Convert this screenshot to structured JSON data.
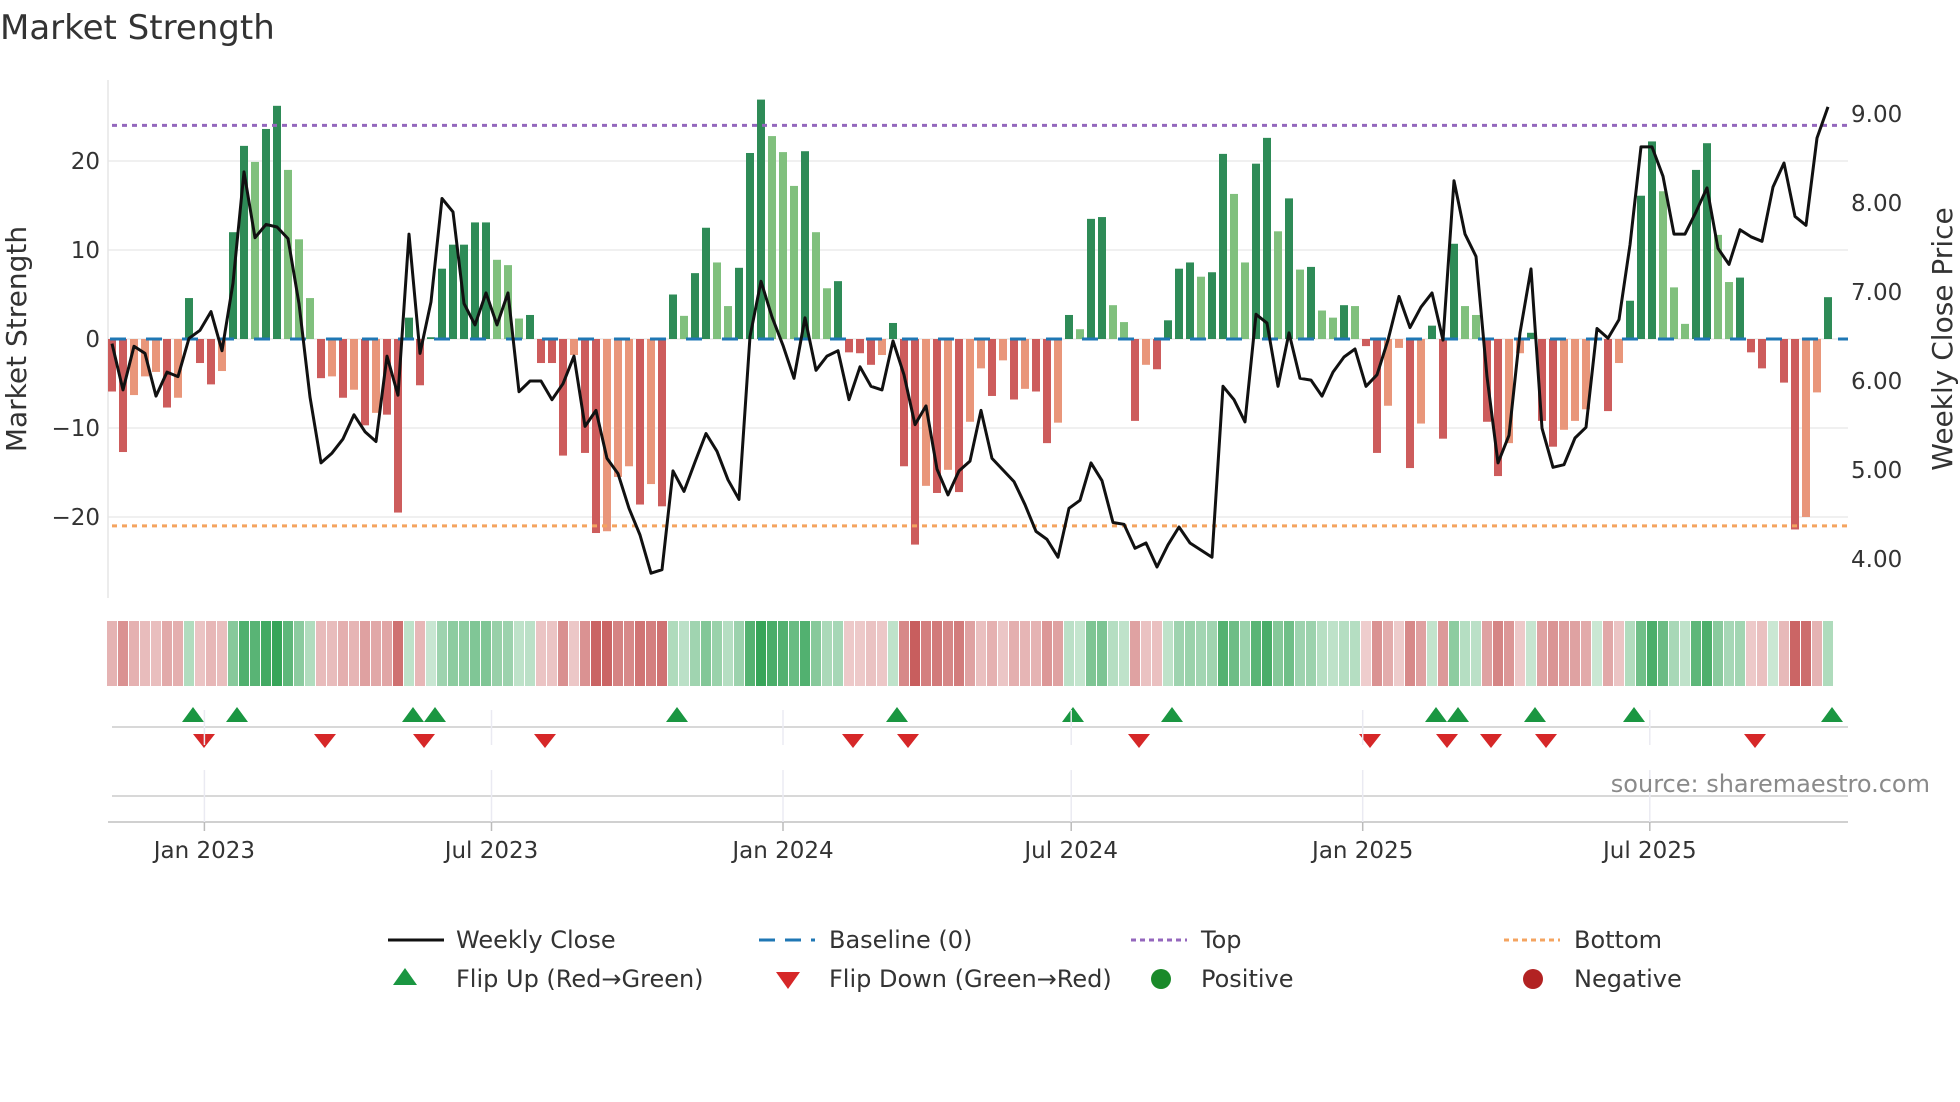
{
  "title": "Market Strength",
  "source": "source: sharemaestro.com",
  "legend": [
    {
      "label": "Weekly Close",
      "icon": "solid-line"
    },
    {
      "label": "Baseline (0)",
      "icon": "dashed-line"
    },
    {
      "label": "Top",
      "icon": "dotted-line"
    },
    {
      "label": "Bottom",
      "icon": "dotted-line"
    },
    {
      "label": "Flip Up (Red→Green)",
      "icon": "triangle-up"
    },
    {
      "label": "Flip Down (Green→Red)",
      "icon": "triangle-down"
    },
    {
      "label": "Positive",
      "icon": "circle"
    },
    {
      "label": "Negative",
      "icon": "circle"
    }
  ],
  "colors": {
    "pos_strong": "#2e8b57",
    "pos_weak": "#80c07d",
    "neg_strong": "#cd5c5c",
    "neg_weak": "#e9967a",
    "line": "#111111",
    "baseline": "#1f77b4",
    "top": "#9467bd",
    "bottom": "#f4a460",
    "flip_up": "#1a9641",
    "flip_down": "#d62728",
    "positive": "#1a8a2a",
    "negative": "#b22222",
    "grid": "#ececec"
  },
  "chart_data": {
    "type": "bar",
    "title": "Market Strength",
    "ylabel": "Market Strength",
    "y2label": "Weekly Close Price",
    "ylim": [
      -28,
      32
    ],
    "y2lim": [
      3.7,
      9.4
    ],
    "yticks": [
      {
        "v": 20,
        "label": "20"
      },
      {
        "v": 10,
        "label": "10"
      },
      {
        "v": 0,
        "label": "0"
      },
      {
        "v": -10,
        "label": "−10"
      },
      {
        "v": -20,
        "label": "−20"
      }
    ],
    "y2ticks": [
      {
        "v": 9,
        "label": "9.00"
      },
      {
        "v": 8,
        "label": "8.00"
      },
      {
        "v": 7,
        "label": "7.00"
      },
      {
        "v": 6,
        "label": "6.00"
      },
      {
        "v": 5,
        "label": "5.00"
      },
      {
        "v": 4,
        "label": "4.00"
      }
    ],
    "xticks": [
      {
        "week": 8.4,
        "label": "Jan 2023"
      },
      {
        "week": 34.5,
        "label": "Jul 2023"
      },
      {
        "week": 61.0,
        "label": "Jan 2024"
      },
      {
        "week": 87.2,
        "label": "Jul 2024"
      },
      {
        "week": 113.7,
        "label": "Jan 2025"
      },
      {
        "week": 139.8,
        "label": "Jul 2025"
      }
    ],
    "top_level": 24,
    "bottom_level": -21,
    "baseline": 0,
    "strength": [
      -5.9,
      -12.7,
      -6.3,
      -4.2,
      -3.7,
      -7.7,
      -6.6,
      4.6,
      -2.7,
      -5.1,
      -3.6,
      12.0,
      21.7,
      19.9,
      23.6,
      26.2,
      19.0,
      11.2,
      4.6,
      -4.4,
      -4.2,
      -6.6,
      -5.7,
      -9.7,
      -8.3,
      -8.5,
      -19.5,
      2.4,
      -5.2,
      0.2,
      7.9,
      10.6,
      10.6,
      13.1,
      13.1,
      8.9,
      8.3,
      2.3,
      2.7,
      -2.7,
      -2.7,
      -13.1,
      -1.8,
      -12.8,
      -21.8,
      -21.6,
      -15.5,
      -14.3,
      -18.6,
      -16.3,
      -18.8,
      5.0,
      2.6,
      7.4,
      12.5,
      8.6,
      3.7,
      8.0,
      20.9,
      26.9,
      22.8,
      21.0,
      17.2,
      21.1,
      12.0,
      5.7,
      6.5,
      -1.5,
      -1.6,
      -2.9,
      -1.8,
      1.8,
      -14.3,
      -23.1,
      -16.5,
      -17.3,
      -14.7,
      -17.2,
      -9.3,
      -3.3,
      -6.4,
      -2.4,
      -6.8,
      -5.6,
      -5.9,
      -11.7,
      -9.4,
      2.7,
      1.1,
      13.5,
      13.7,
      3.8,
      1.9,
      -9.2,
      -2.9,
      -3.4,
      2.1,
      7.9,
      8.6,
      7.0,
      7.5,
      20.8,
      16.3,
      8.6,
      19.7,
      22.6,
      12.1,
      15.8,
      7.8,
      8.1,
      3.2,
      2.4,
      3.8,
      3.7,
      -0.8,
      -12.8,
      -7.5,
      -1.0,
      -14.5,
      -9.5,
      1.5,
      -11.2,
      10.7,
      3.7,
      2.7,
      -9.3,
      -15.4,
      -11.7,
      -1.6,
      0.7,
      -9.2,
      -12.1,
      -10.2,
      -9.2,
      -7.9,
      0,
      -8.1,
      -2.7,
      4.3,
      16.1,
      22.2,
      16.6,
      5.8,
      1.7,
      19.0,
      22.0,
      11.7,
      6.4,
      6.9,
      -1.5,
      -3.3,
      0,
      -4.9,
      -21.4,
      -20.0,
      -6.0,
      4.7
    ],
    "weekly_close": [
      6.42,
      5.9,
      6.39,
      6.31,
      5.83,
      6.1,
      6.05,
      6.48,
      6.57,
      6.78,
      6.34,
      7.1,
      8.35,
      7.61,
      7.76,
      7.73,
      7.6,
      6.87,
      5.82,
      5.08,
      5.19,
      5.35,
      5.62,
      5.43,
      5.32,
      6.28,
      5.84,
      7.65,
      6.31,
      6.89,
      8.05,
      7.9,
      6.87,
      6.63,
      6.99,
      6.63,
      6.99,
      5.88,
      6.0,
      6.0,
      5.79,
      5.97,
      6.28,
      5.49,
      5.67,
      5.13,
      4.96,
      4.57,
      4.27,
      3.84,
      3.88,
      4.99,
      4.76,
      5.09,
      5.41,
      5.21,
      4.89,
      4.67,
      6.5,
      7.12,
      6.72,
      6.4,
      6.03,
      6.71,
      6.12,
      6.28,
      6.34,
      5.79,
      6.16,
      5.94,
      5.9,
      6.45,
      6.07,
      5.51,
      5.72,
      5.01,
      4.72,
      4.99,
      5.1,
      5.67,
      5.13,
      5.0,
      4.87,
      4.61,
      4.31,
      4.22,
      4.02,
      4.57,
      4.66,
      5.08,
      4.88,
      4.41,
      4.39,
      4.12,
      4.18,
      3.91,
      4.16,
      4.36,
      4.18,
      4.1,
      4.02,
      5.94,
      5.79,
      5.54,
      6.75,
      6.65,
      5.94,
      6.54,
      6.03,
      6.01,
      5.83,
      6.1,
      6.27,
      6.36,
      5.94,
      6.07,
      6.46,
      6.95,
      6.6,
      6.83,
      6.99,
      6.46,
      8.25,
      7.65,
      7.4,
      6.05,
      5.08,
      5.39,
      6.54,
      7.26,
      5.47,
      5.03,
      5.06,
      5.36,
      5.48,
      6.59,
      6.48,
      6.69,
      7.53,
      8.63,
      8.63,
      8.3,
      7.65,
      7.65,
      7.9,
      8.17,
      7.49,
      7.31,
      7.7,
      7.62,
      7.57,
      8.18,
      8.45,
      7.85,
      7.75,
      8.73,
      9.08
    ],
    "flip_up_weeks": [
      7,
      11,
      27,
      29,
      51,
      71,
      87,
      96,
      120,
      122,
      129,
      138,
      156
    ],
    "flip_down_weeks": [
      8,
      19,
      28,
      39,
      67,
      72,
      93,
      114,
      121,
      125,
      130,
      149
    ],
    "grid": true,
    "legend_position": "bottom"
  }
}
